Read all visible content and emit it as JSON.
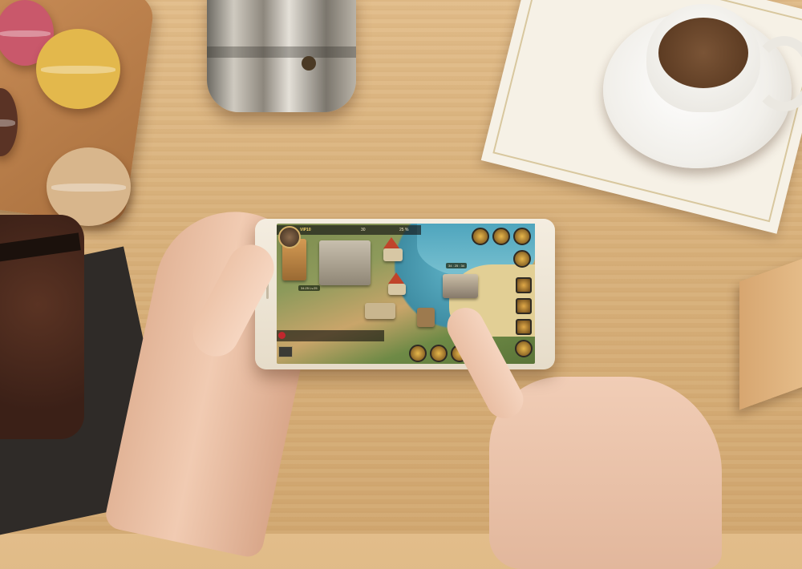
{
  "scene": {
    "subject": "hands-holding-smartphone-playing-strategy-game"
  },
  "game": {
    "vip_label": "VIP10",
    "resource_1": "30",
    "resource_2": "25 %",
    "city_plate_1": "34:25 Lv.25",
    "city_plate_2": "34 : 25 : 34",
    "icons": {
      "right_column": [
        "shield-icon",
        "chest-icon",
        "sword-icon",
        "gift-icon",
        "scroll-icon",
        "coin-icon",
        "crown-icon",
        "gem-icon"
      ],
      "bottom_row": [
        "hero-icon",
        "army-icon",
        "build-icon",
        "map-icon"
      ]
    }
  },
  "colors": {
    "wood": "#d9b27c",
    "phone_body": "#eee4d2",
    "sea": "#4fa5bd",
    "ui_gold": "#e6b64b"
  }
}
